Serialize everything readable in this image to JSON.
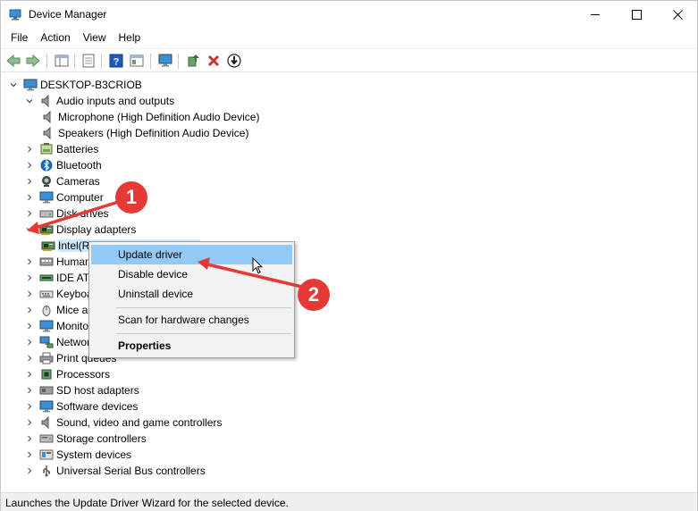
{
  "window": {
    "title": "Device Manager",
    "controls": {
      "minimize": "minimize-icon",
      "maximize": "maximize-icon",
      "close": "close-icon"
    }
  },
  "menubar": {
    "items": [
      "File",
      "Action",
      "View",
      "Help"
    ]
  },
  "toolbar": {
    "buttons": [
      "back-arrow-icon",
      "forward-arrow-icon",
      "properties-pane-icon",
      "show-hide-icon",
      "help-icon",
      "details-icon",
      "monitor-scan-icon",
      "update-driver-icon",
      "uninstall-x-icon",
      "download-icon"
    ],
    "uninstall_color": "#d32f2f",
    "help_color": "#1e5bb8"
  },
  "tree": {
    "root": "DESKTOP-B3CRIOB",
    "nodes": [
      {
        "label": "Audio inputs and outputs",
        "icon": "speaker-icon",
        "expanded": true
      },
      {
        "label": "Microphone (High Definition Audio Device)",
        "icon": "speaker-icon",
        "child": true
      },
      {
        "label": "Speakers (High Definition Audio Device)",
        "icon": "speaker-icon",
        "child": true
      },
      {
        "label": "Batteries",
        "icon": "battery-icon"
      },
      {
        "label": "Bluetooth",
        "icon": "bluetooth-icon"
      },
      {
        "label": "Cameras",
        "icon": "camera-icon"
      },
      {
        "label": "Computer",
        "icon": "computer-icon"
      },
      {
        "label": "Disk drives",
        "icon": "disk-icon"
      },
      {
        "label": "Display adapters",
        "icon": "display-adapter-icon",
        "expanded": true
      },
      {
        "label": "Intel(R) UHD Graphics Family",
        "icon": "display-adapter-icon",
        "child": true,
        "selected": true
      },
      {
        "label": "Human Interface Devices",
        "icon": "hid-icon"
      },
      {
        "label": "IDE ATA/ATAPI controllers",
        "icon": "ide-icon"
      },
      {
        "label": "Keyboards",
        "icon": "keyboard-icon"
      },
      {
        "label": "Mice and other pointing devices",
        "icon": "mouse-icon"
      },
      {
        "label": "Monitors",
        "icon": "monitor-icon"
      },
      {
        "label": "Network adapters",
        "icon": "network-icon"
      },
      {
        "label": "Print queues",
        "icon": "printer-icon"
      },
      {
        "label": "Processors",
        "icon": "processor-icon"
      },
      {
        "label": "SD host adapters",
        "icon": "sd-card-icon"
      },
      {
        "label": "Software devices",
        "icon": "software-device-icon"
      },
      {
        "label": "Sound, video and game controllers",
        "icon": "speaker-icon"
      },
      {
        "label": "Storage controllers",
        "icon": "storage-icon"
      },
      {
        "label": "System devices",
        "icon": "system-device-icon"
      },
      {
        "label": "Universal Serial Bus controllers",
        "icon": "usb-icon"
      }
    ]
  },
  "context_menu": {
    "items": [
      {
        "label": "Update driver",
        "highlighted": true
      },
      {
        "label": "Disable device"
      },
      {
        "label": "Uninstall device"
      },
      {
        "label": "Scan for hardware changes"
      },
      {
        "label": "Properties",
        "bold": true
      }
    ],
    "highlight_color": "#91c9f7"
  },
  "annotations": {
    "badge1": "1",
    "badge2": "2",
    "color": "#e53935"
  },
  "statusbar": {
    "text": "Launches the Update Driver Wizard for the selected device."
  }
}
